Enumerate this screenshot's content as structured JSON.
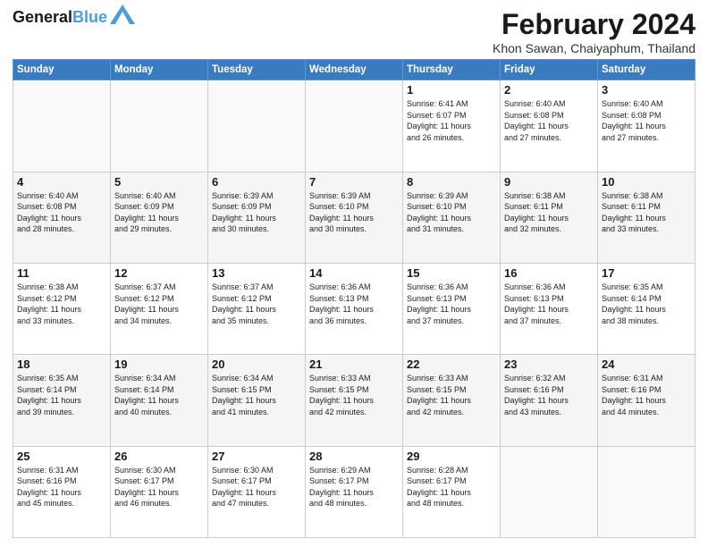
{
  "header": {
    "logo_line1": "General",
    "logo_line2": "Blue",
    "month_title": "February 2024",
    "location": "Khon Sawan, Chaiyaphum, Thailand"
  },
  "days_of_week": [
    "Sunday",
    "Monday",
    "Tuesday",
    "Wednesday",
    "Thursday",
    "Friday",
    "Saturday"
  ],
  "weeks": [
    [
      {
        "day": "",
        "info": ""
      },
      {
        "day": "",
        "info": ""
      },
      {
        "day": "",
        "info": ""
      },
      {
        "day": "",
        "info": ""
      },
      {
        "day": "1",
        "info": "Sunrise: 6:41 AM\nSunset: 6:07 PM\nDaylight: 11 hours\nand 26 minutes."
      },
      {
        "day": "2",
        "info": "Sunrise: 6:40 AM\nSunset: 6:08 PM\nDaylight: 11 hours\nand 27 minutes."
      },
      {
        "day": "3",
        "info": "Sunrise: 6:40 AM\nSunset: 6:08 PM\nDaylight: 11 hours\nand 27 minutes."
      }
    ],
    [
      {
        "day": "4",
        "info": "Sunrise: 6:40 AM\nSunset: 6:08 PM\nDaylight: 11 hours\nand 28 minutes."
      },
      {
        "day": "5",
        "info": "Sunrise: 6:40 AM\nSunset: 6:09 PM\nDaylight: 11 hours\nand 29 minutes."
      },
      {
        "day": "6",
        "info": "Sunrise: 6:39 AM\nSunset: 6:09 PM\nDaylight: 11 hours\nand 30 minutes."
      },
      {
        "day": "7",
        "info": "Sunrise: 6:39 AM\nSunset: 6:10 PM\nDaylight: 11 hours\nand 30 minutes."
      },
      {
        "day": "8",
        "info": "Sunrise: 6:39 AM\nSunset: 6:10 PM\nDaylight: 11 hours\nand 31 minutes."
      },
      {
        "day": "9",
        "info": "Sunrise: 6:38 AM\nSunset: 6:11 PM\nDaylight: 11 hours\nand 32 minutes."
      },
      {
        "day": "10",
        "info": "Sunrise: 6:38 AM\nSunset: 6:11 PM\nDaylight: 11 hours\nand 33 minutes."
      }
    ],
    [
      {
        "day": "11",
        "info": "Sunrise: 6:38 AM\nSunset: 6:12 PM\nDaylight: 11 hours\nand 33 minutes."
      },
      {
        "day": "12",
        "info": "Sunrise: 6:37 AM\nSunset: 6:12 PM\nDaylight: 11 hours\nand 34 minutes."
      },
      {
        "day": "13",
        "info": "Sunrise: 6:37 AM\nSunset: 6:12 PM\nDaylight: 11 hours\nand 35 minutes."
      },
      {
        "day": "14",
        "info": "Sunrise: 6:36 AM\nSunset: 6:13 PM\nDaylight: 11 hours\nand 36 minutes."
      },
      {
        "day": "15",
        "info": "Sunrise: 6:36 AM\nSunset: 6:13 PM\nDaylight: 11 hours\nand 37 minutes."
      },
      {
        "day": "16",
        "info": "Sunrise: 6:36 AM\nSunset: 6:13 PM\nDaylight: 11 hours\nand 37 minutes."
      },
      {
        "day": "17",
        "info": "Sunrise: 6:35 AM\nSunset: 6:14 PM\nDaylight: 11 hours\nand 38 minutes."
      }
    ],
    [
      {
        "day": "18",
        "info": "Sunrise: 6:35 AM\nSunset: 6:14 PM\nDaylight: 11 hours\nand 39 minutes."
      },
      {
        "day": "19",
        "info": "Sunrise: 6:34 AM\nSunset: 6:14 PM\nDaylight: 11 hours\nand 40 minutes."
      },
      {
        "day": "20",
        "info": "Sunrise: 6:34 AM\nSunset: 6:15 PM\nDaylight: 11 hours\nand 41 minutes."
      },
      {
        "day": "21",
        "info": "Sunrise: 6:33 AM\nSunset: 6:15 PM\nDaylight: 11 hours\nand 42 minutes."
      },
      {
        "day": "22",
        "info": "Sunrise: 6:33 AM\nSunset: 6:15 PM\nDaylight: 11 hours\nand 42 minutes."
      },
      {
        "day": "23",
        "info": "Sunrise: 6:32 AM\nSunset: 6:16 PM\nDaylight: 11 hours\nand 43 minutes."
      },
      {
        "day": "24",
        "info": "Sunrise: 6:31 AM\nSunset: 6:16 PM\nDaylight: 11 hours\nand 44 minutes."
      }
    ],
    [
      {
        "day": "25",
        "info": "Sunrise: 6:31 AM\nSunset: 6:16 PM\nDaylight: 11 hours\nand 45 minutes."
      },
      {
        "day": "26",
        "info": "Sunrise: 6:30 AM\nSunset: 6:17 PM\nDaylight: 11 hours\nand 46 minutes."
      },
      {
        "day": "27",
        "info": "Sunrise: 6:30 AM\nSunset: 6:17 PM\nDaylight: 11 hours\nand 47 minutes."
      },
      {
        "day": "28",
        "info": "Sunrise: 6:29 AM\nSunset: 6:17 PM\nDaylight: 11 hours\nand 48 minutes."
      },
      {
        "day": "29",
        "info": "Sunrise: 6:28 AM\nSunset: 6:17 PM\nDaylight: 11 hours\nand 48 minutes."
      },
      {
        "day": "",
        "info": ""
      },
      {
        "day": "",
        "info": ""
      }
    ]
  ]
}
